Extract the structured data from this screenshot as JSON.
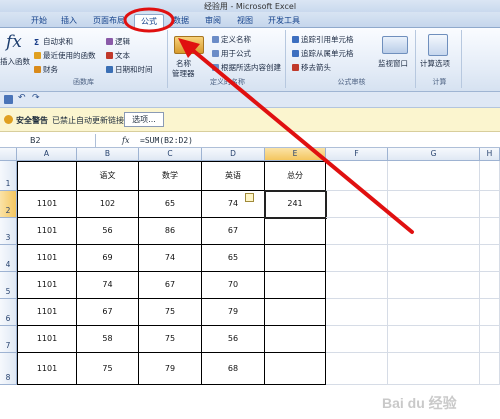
{
  "window": {
    "title": "经验用 - Microsoft Excel"
  },
  "tabs": [
    "开始",
    "插入",
    "页面布局",
    "公式",
    "数据",
    "审阅",
    "视图",
    "开发工具"
  ],
  "active_tab": "公式",
  "ribbon": {
    "function_library": {
      "group_label": "函数库",
      "insert_function": "插入函数",
      "autosum": "自动求和",
      "recently_used": "最近使用的函数",
      "finance": "财务",
      "logical": "逻辑",
      "text": "文本",
      "date_time": "日期和时间"
    },
    "defined_names": {
      "group_label": "定义的名称",
      "name_manager_line1": "名称",
      "name_manager_line2": "管理器",
      "define_name": "定义名称",
      "use_in_formula": "用于公式",
      "create_from_selection": "根据所选内容创建"
    },
    "formula_auditing": {
      "group_label": "公式审核",
      "trace_precedents": "追踪引用单元格",
      "trace_dependents": "追踪从属单元格",
      "remove_arrows": "移去箭头",
      "watch_window": "监视窗口"
    },
    "calculation": {
      "group_label": "计算",
      "calc_options": "计算选项"
    }
  },
  "security_bar": {
    "title": "安全警告",
    "message": "已禁止自动更新链接",
    "options_button": "选项..."
  },
  "formula_bar": {
    "name_box": "B2",
    "fx": "fx",
    "formula": "=SUM(B2:D2)"
  },
  "columns": [
    "A",
    "B",
    "C",
    "D",
    "E",
    "F",
    "G",
    "H"
  ],
  "rows": [
    "1",
    "2",
    "3",
    "4",
    "5",
    "6",
    "7",
    "8"
  ],
  "table": {
    "headers": [
      "",
      "语文",
      "数学",
      "英语",
      "总分"
    ],
    "rows": [
      [
        "1101",
        "102",
        "65",
        "74",
        "241"
      ],
      [
        "1101",
        "56",
        "86",
        "67",
        ""
      ],
      [
        "1101",
        "69",
        "74",
        "65",
        ""
      ],
      [
        "1101",
        "74",
        "67",
        "70",
        ""
      ],
      [
        "1101",
        "67",
        "75",
        "79",
        ""
      ],
      [
        "1101",
        "58",
        "75",
        "56",
        ""
      ],
      [
        "1101",
        "75",
        "79",
        "68",
        ""
      ]
    ]
  },
  "annotation": {
    "color": "#e01010",
    "target": "公式"
  },
  "watermark": {
    "text": "Bai du 经验"
  }
}
